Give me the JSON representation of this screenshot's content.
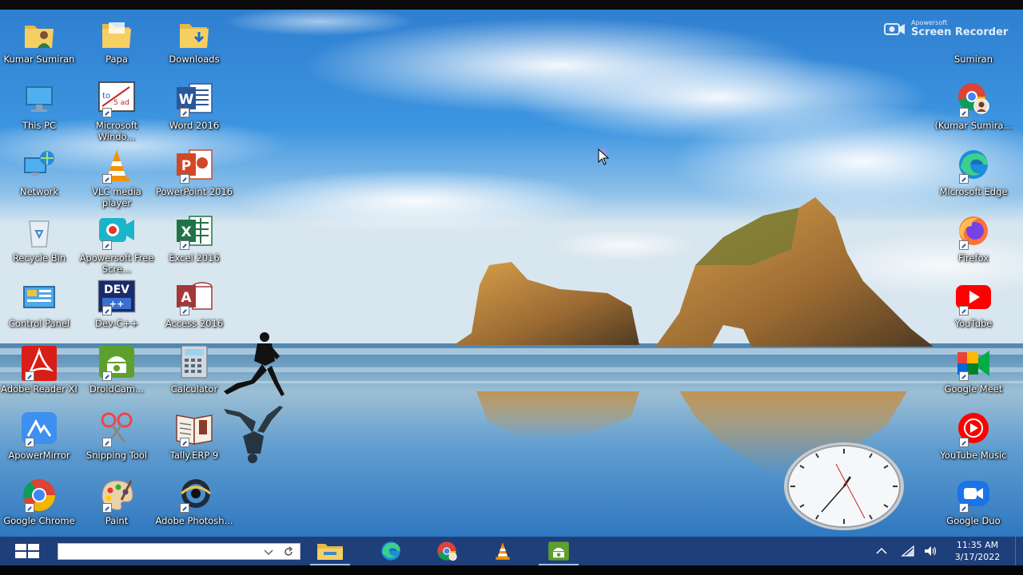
{
  "watermark": {
    "line1": "Apowersoft",
    "line2": "Screen Recorder"
  },
  "desktop": {
    "icons": [
      {
        "label": "Kumar Sumiran"
      },
      {
        "label": "Papa"
      },
      {
        "label": "Downloads"
      },
      {
        "label": "This PC"
      },
      {
        "label": "Microsoft Windo..."
      },
      {
        "label": "Word 2016"
      },
      {
        "label": "Network"
      },
      {
        "label": "VLC media player"
      },
      {
        "label": "PowerPoint 2016"
      },
      {
        "label": "Recycle Bin"
      },
      {
        "label": "Apowersoft Free Scre..."
      },
      {
        "label": "Excel 2016"
      },
      {
        "label": "Control Panel"
      },
      {
        "label": "Dev-C++"
      },
      {
        "label": "Access 2016"
      },
      {
        "label": "Adobe Reader XI"
      },
      {
        "label": "DroidCam..."
      },
      {
        "label": "Calculator"
      },
      {
        "label": "ApowerMirror"
      },
      {
        "label": "Snipping Tool"
      },
      {
        "label": "Tally.ERP 9"
      },
      {
        "label": "Google Chrome"
      },
      {
        "label": "Paint"
      },
      {
        "label": "Adobe Photosh..."
      },
      {
        "label": "Sumiran"
      },
      {
        "label": "(Kumar Sumira..."
      },
      {
        "label": "Microsoft Edge"
      },
      {
        "label": "Firefox"
      },
      {
        "label": "YouTube"
      },
      {
        "label": "Google Meet"
      },
      {
        "label": "YouTube Music"
      },
      {
        "label": "Google Duo"
      }
    ],
    "dev_icon_text": "DEV",
    "excel_letter": "X",
    "access_letter": "A",
    "word_letter": "W",
    "powerpoint_letter": "P"
  },
  "taskbar": {
    "search_value": "",
    "pinned": [
      "file-explorer",
      "edge",
      "chrome",
      "vlc",
      "droidcam"
    ],
    "time": "11:35 AM",
    "date": "3/17/2022"
  },
  "colors": {
    "taskbar": "#1f3f7a",
    "accent": "#9cc7ff"
  }
}
